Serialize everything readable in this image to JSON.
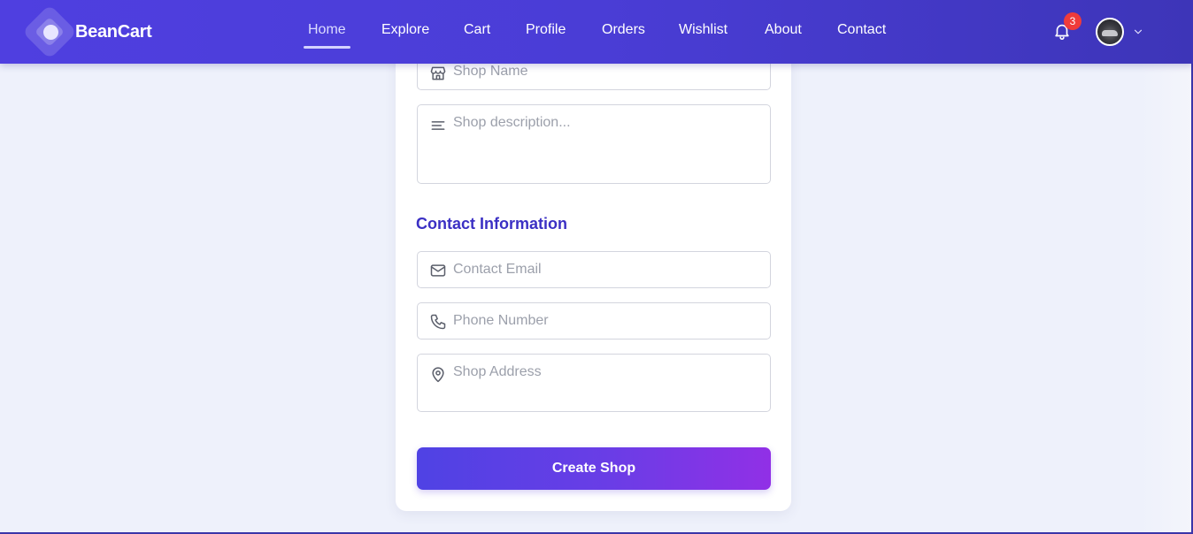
{
  "app": {
    "brand": "BeanCart"
  },
  "nav": {
    "items": [
      {
        "label": "Home",
        "active": true
      },
      {
        "label": "Explore"
      },
      {
        "label": "Cart"
      },
      {
        "label": "Profile"
      },
      {
        "label": "Orders"
      },
      {
        "label": "Wishlist"
      },
      {
        "label": "About"
      },
      {
        "label": "Contact"
      }
    ]
  },
  "header": {
    "notifications_count": "3",
    "icons": [
      "bell-icon",
      "avatar",
      "chevron-down-icon"
    ]
  },
  "form": {
    "shop_name_placeholder": "Shop Name",
    "shop_description_placeholder": "Shop description...",
    "contact_section_title": "Contact Information",
    "contact_email_placeholder": "Contact Email",
    "phone_number_placeholder": "Phone Number",
    "shop_address_placeholder": "Shop Address",
    "submit_label": "Create Shop"
  },
  "colors": {
    "nav_start": "#4f3fe0",
    "nav_end": "#3d35b8",
    "accent": "#3b30c4",
    "button_start": "#4f42e4",
    "button_end": "#9130e6",
    "badge": "#ef3b3b",
    "page_bg": "#eef1fb"
  }
}
